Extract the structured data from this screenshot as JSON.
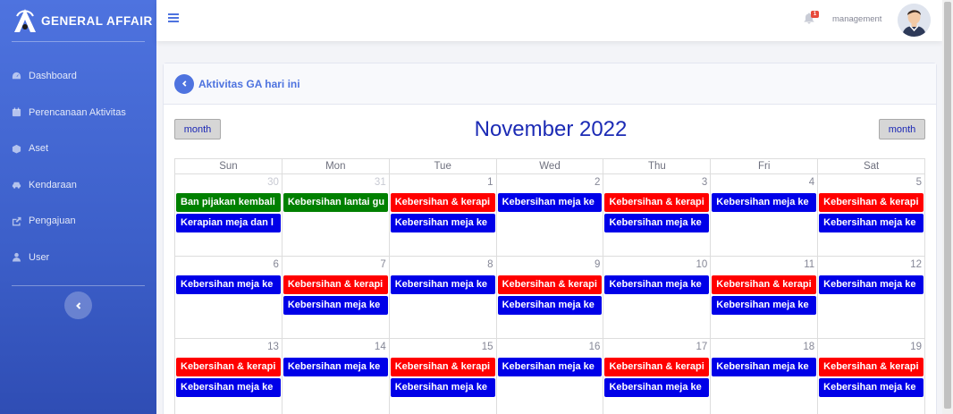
{
  "brand": {
    "name": "GENERAL AFFAIR"
  },
  "sidebar": {
    "items": [
      {
        "label": "Dashboard",
        "icon": "dashboard-icon"
      },
      {
        "label": "Perencanaan Aktivitas",
        "icon": "calendar-icon"
      },
      {
        "label": "Aset",
        "icon": "box-icon"
      },
      {
        "label": "Kendaraan",
        "icon": "car-icon"
      },
      {
        "label": "Pengajuan",
        "icon": "share-icon"
      },
      {
        "label": "User",
        "icon": "user-icon"
      }
    ]
  },
  "topbar": {
    "notification_count": "1",
    "user_name": "management"
  },
  "card": {
    "title": "Aktivitas GA hari ini"
  },
  "calendar": {
    "title": "November 2022",
    "left_button": "month",
    "right_button": "month",
    "days_of_week": [
      "Sun",
      "Mon",
      "Tue",
      "Wed",
      "Thu",
      "Fri",
      "Sat"
    ],
    "weeks": [
      [
        {
          "num": "30",
          "other": true,
          "events": [
            {
              "title": "Ban pijakan kembali",
              "color": "green"
            },
            {
              "title": "Kerapian meja dan l",
              "color": "blue"
            }
          ]
        },
        {
          "num": "31",
          "other": true,
          "events": [
            {
              "title": "Kebersihan lantai gu",
              "color": "green"
            }
          ]
        },
        {
          "num": "1",
          "events": [
            {
              "title": "Kebersihan & kerapi",
              "color": "red"
            },
            {
              "title": "Kebersihan meja ke",
              "color": "blue"
            }
          ]
        },
        {
          "num": "2",
          "events": [
            {
              "title": "Kebersihan meja ke",
              "color": "blue"
            }
          ]
        },
        {
          "num": "3",
          "events": [
            {
              "title": "Kebersihan & kerapi",
              "color": "red"
            },
            {
              "title": "Kebersihan meja ke",
              "color": "blue"
            }
          ]
        },
        {
          "num": "4",
          "events": [
            {
              "title": "Kebersihan meja ke",
              "color": "blue"
            }
          ]
        },
        {
          "num": "5",
          "events": [
            {
              "title": "Kebersihan & kerapi",
              "color": "red"
            },
            {
              "title": "Kebersihan meja ke",
              "color": "blue"
            }
          ]
        }
      ],
      [
        {
          "num": "6",
          "events": [
            {
              "title": "Kebersihan meja ke",
              "color": "blue"
            }
          ]
        },
        {
          "num": "7",
          "events": [
            {
              "title": "Kebersihan & kerapi",
              "color": "red"
            },
            {
              "title": "Kebersihan meja ke",
              "color": "blue"
            }
          ]
        },
        {
          "num": "8",
          "events": [
            {
              "title": "Kebersihan meja ke",
              "color": "blue"
            }
          ]
        },
        {
          "num": "9",
          "events": [
            {
              "title": "Kebersihan & kerapi",
              "color": "red"
            },
            {
              "title": "Kebersihan meja ke",
              "color": "blue"
            }
          ]
        },
        {
          "num": "10",
          "events": [
            {
              "title": "Kebersihan meja ke",
              "color": "blue"
            }
          ]
        },
        {
          "num": "11",
          "events": [
            {
              "title": "Kebersihan & kerapi",
              "color": "red"
            },
            {
              "title": "Kebersihan meja ke",
              "color": "blue"
            }
          ]
        },
        {
          "num": "12",
          "events": [
            {
              "title": "Kebersihan meja ke",
              "color": "blue"
            }
          ]
        }
      ],
      [
        {
          "num": "13",
          "events": [
            {
              "title": "Kebersihan & kerapi",
              "color": "red"
            },
            {
              "title": "Kebersihan meja ke",
              "color": "blue"
            }
          ]
        },
        {
          "num": "14",
          "events": [
            {
              "title": "Kebersihan meja ke",
              "color": "blue"
            }
          ]
        },
        {
          "num": "15",
          "events": [
            {
              "title": "Kebersihan & kerapi",
              "color": "red"
            },
            {
              "title": "Kebersihan meja ke",
              "color": "blue"
            }
          ]
        },
        {
          "num": "16",
          "events": [
            {
              "title": "Kebersihan meja ke",
              "color": "blue"
            }
          ]
        },
        {
          "num": "17",
          "events": [
            {
              "title": "Kebersihan & kerapi",
              "color": "red"
            },
            {
              "title": "Kebersihan meja ke",
              "color": "blue"
            }
          ]
        },
        {
          "num": "18",
          "events": [
            {
              "title": "Kebersihan meja ke",
              "color": "blue"
            }
          ]
        },
        {
          "num": "19",
          "events": [
            {
              "title": "Kebersihan & kerapi",
              "color": "red"
            },
            {
              "title": "Kebersihan meja ke",
              "color": "blue"
            }
          ]
        }
      ]
    ]
  },
  "colors": {
    "primary": "#4e73df",
    "event_red": "#ff0000",
    "event_blue": "#0000e8",
    "event_green": "#008000",
    "title_blue": "#1c2bb5"
  }
}
